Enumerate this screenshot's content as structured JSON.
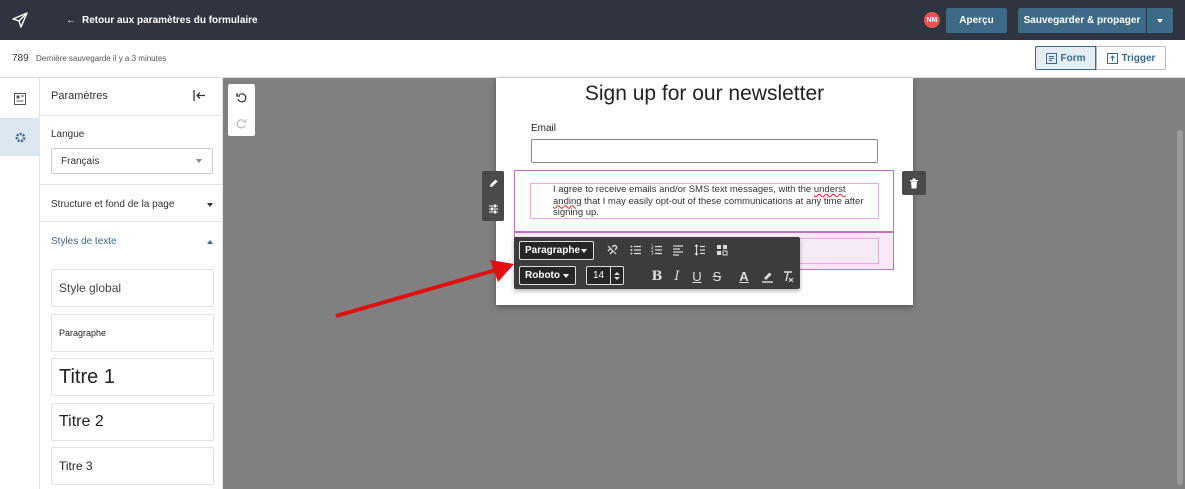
{
  "topbar": {
    "back_label": "Retour aux paramètres du formulaire",
    "avatar_initials": "NM",
    "preview_label": "Aperçu",
    "save_label": "Sauvegarder & propager"
  },
  "subbar": {
    "form_id": "789",
    "saved_status": "Dernière sauvegarde il y a 3 minutes",
    "tab_form": "Form",
    "tab_trigger": "Trigger"
  },
  "panel": {
    "title": "Paramètres",
    "language_label": "Langue",
    "language_value": "Français",
    "section_structure": "Structure et fond de la page",
    "section_text_styles": "Styles de texte",
    "styles": [
      "Style global",
      "Paragraphe",
      "Titre 1",
      "Titre 2",
      "Titre 3"
    ]
  },
  "form": {
    "title": "Sign up for our newsletter",
    "email_label": "Email",
    "consent_part1": "I agree to receive emails and/or SMS text messages, with the ",
    "consent_misspelled1": "underst",
    "consent_misspelled2": "anding",
    "consent_part2": " that I may easily opt-out of these communications at any time after signing up."
  },
  "toolbar": {
    "block_type": "Paragraphe",
    "font": "Roboto",
    "font_size": "14",
    "bold": "B",
    "italic": "I",
    "underline": "U",
    "strike": "S",
    "text_color": "A"
  },
  "colors": {
    "topbar_bg": "#2e3440",
    "accent": "#3d6a86",
    "canvas_bg": "#808080",
    "selection": "#c46fc4",
    "arrow": "#e01010"
  }
}
